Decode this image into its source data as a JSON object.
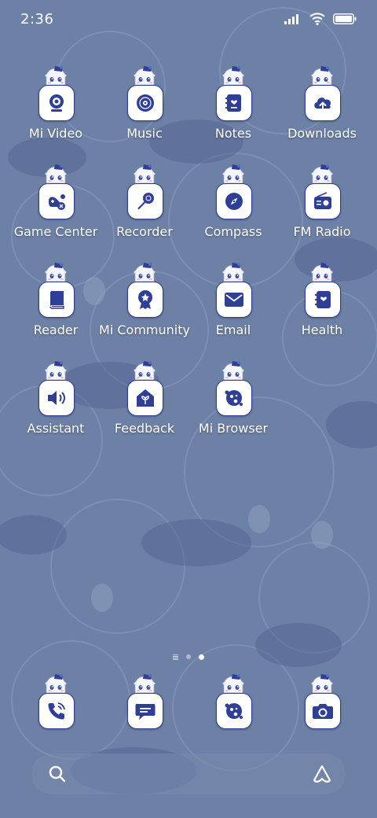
{
  "status_bar": {
    "time": "2:36"
  },
  "apps": [
    {
      "label": "Mi Video",
      "icon": "webcam-icon"
    },
    {
      "label": "Music",
      "icon": "vinyl-record-icon"
    },
    {
      "label": "Notes",
      "icon": "notebook-heart-icon"
    },
    {
      "label": "Downloads",
      "icon": "cloud-upload-icon"
    },
    {
      "label": "Game Center",
      "icon": "gamepad-icon"
    },
    {
      "label": "Recorder",
      "icon": "microphone-icon"
    },
    {
      "label": "Compass",
      "icon": "compass-icon"
    },
    {
      "label": "FM Radio",
      "icon": "radio-icon"
    },
    {
      "label": "Reader",
      "icon": "book-icon"
    },
    {
      "label": "Mi Community",
      "icon": "badge-icon"
    },
    {
      "label": "Email",
      "icon": "envelope-icon"
    },
    {
      "label": "Health",
      "icon": "health-book-icon"
    },
    {
      "label": "Assistant",
      "icon": "speaker-icon"
    },
    {
      "label": "Feedback",
      "icon": "house-leaf-icon"
    },
    {
      "label": "Mi Browser",
      "icon": "planet-icon"
    }
  ],
  "dock": [
    {
      "icon": "phone-icon"
    },
    {
      "icon": "message-icon"
    },
    {
      "icon": "planet-icon"
    },
    {
      "icon": "camera-icon"
    }
  ],
  "page_indicator": {
    "pages": 3,
    "active": 2
  },
  "colors": {
    "background": "#6d80a5",
    "icon_accent": "#2e3f95",
    "tile": "#ffffff"
  }
}
